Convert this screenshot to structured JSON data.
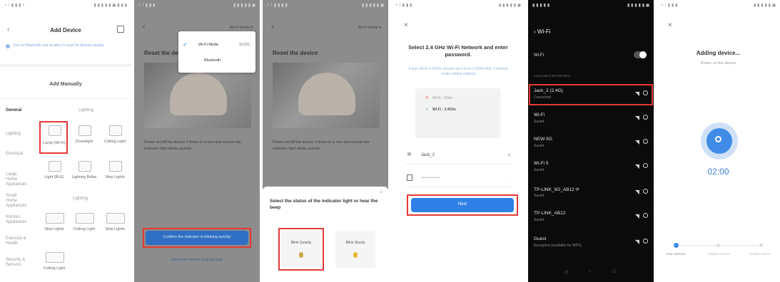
{
  "panel1": {
    "status_left": "• ! ▮ ▮ ▮ •",
    "status_right": "▮ ▮ ▮ ▮ ▮ ◼ ▮ ▮ ▮",
    "title": "Add Device",
    "notice": "Turn on Bluetooth and location to scan for devices nearby.",
    "section_title": "Add Manually",
    "categories": [
      "General",
      "Lighting",
      "Electrical",
      "Large Home Appliances",
      "Small Home Appliances",
      "Kitchen Appliances",
      "Exercise & Health",
      "Security & Sensors"
    ],
    "tabs": [
      "Lighting",
      "Lighting"
    ],
    "items": [
      "Lamp (Wi-Fi)",
      "Downlight",
      "Ceiling Light",
      "Ceiling Light",
      "Light (BLE)",
      "Lighting Bulbs",
      "Strip Lights",
      "Strip Lights",
      "Ceiling Light",
      "Strip Lights"
    ]
  },
  "panel2": {
    "status_left": "• ! ▮ ▮ ▮",
    "status_right": "▮ ▮ ▮ ▮ ▮ ◼",
    "back": "‹",
    "top_right": "Wi-Fi Mode ▾",
    "heading": "Reset the device",
    "popup_wifi": "Wi-Fi Mode",
    "popup_default": "EZ(D)",
    "popup_bt": "Bluetooth",
    "instructions": "Power on/off the device 3 times in a row and ensure the indicator light blinks quickly.",
    "button": "Confirm the indicator is blinking quickly",
    "link": "Reset the device step by step"
  },
  "panel3": {
    "status_left": "• ! ▮ ▮ ▮ ▮",
    "status_right": "▮ ▮ ▮ ▮ ▮ ◼",
    "back": "‹",
    "top_right": "Wi-Fi Mode ▾",
    "heading": "Reset the device",
    "instructions": "Power on/off the device 3 times in a row and ensure the indicator light blinks quickly.",
    "sheet_title": "Select the status of the indicator light or hear the beep",
    "option1": "Blink Quickly",
    "option2": "Blink Slowly"
  },
  "panel4": {
    "status_left": "• ! ▮ ▮ ▮",
    "status_right": "▮ ▮ ▮ ▮ ▮ ◼",
    "close": "×",
    "title": "Select 2.4 GHz Wi-Fi Network and enter password.",
    "subtitle": "If your Wi-Fi is 5GHz, please set it to be 2.4GHz first. Common router setting method",
    "wifi_5g": "Wi-Fi - 5Ghz",
    "wifi_24g": "Wi-Fi - 2.4Ghz",
    "ssid": "Jack_2",
    "password_mask": "••••••••••",
    "next": "Next"
  },
  "panel5": {
    "status_left": "▮ ▮ ▮ ▮ ▮",
    "status_right": "▮ ▮ ▮ ▮ ▮ ◼",
    "title": "‹  Wi-Fi",
    "wifi_label": "Wi-Fi",
    "section": "AVAILABLE NETWORKS",
    "networks": [
      {
        "name": "Jack_2 (2.4G)",
        "sub": "Connected"
      },
      {
        "name": "Wi-Fi",
        "sub": "Saved"
      },
      {
        "name": "NEW-5G",
        "sub": "Saved"
      },
      {
        "name": "Wi-Fi 5",
        "sub": "Saved"
      },
      {
        "name": "TP-LINK_5G_AB12  ⟳",
        "sub": "Saved"
      },
      {
        "name": "TP-LINK_AB12",
        "sub": "Saved"
      },
      {
        "name": "Guest",
        "sub": "Encrypted (available for WPS)"
      }
    ],
    "nav": [
      "◁",
      "○",
      "□"
    ]
  },
  "panel6": {
    "status_left": "• ! ▮ ▮ ▮",
    "status_right": "▮ ▮ ▮ ▮ ▮ ◼",
    "close": "×",
    "title": "Adding device...",
    "subtitle": "Power on the device",
    "timer": "02:00",
    "steps": [
      "Scan devices",
      "Register device",
      "Initialize device"
    ]
  },
  "colors": {
    "accent": "#2b7fd4",
    "blue_button": "#2f80e6",
    "red_box": "#e53935",
    "dark_bg": "#0b0b0b",
    "gray_bg": "#8c8c8c"
  }
}
